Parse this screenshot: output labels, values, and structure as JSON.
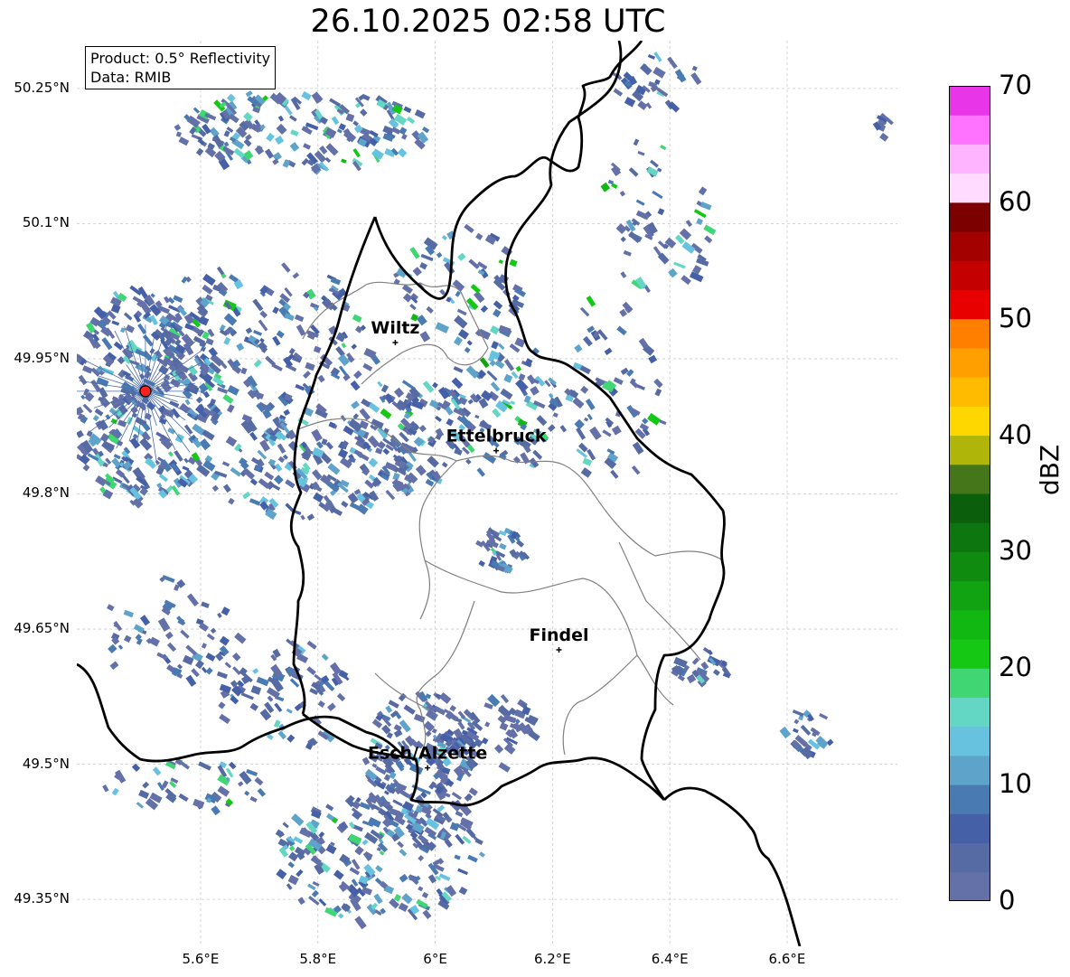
{
  "title": "26.10.2025 02:58 UTC",
  "info": {
    "product": "Product: 0.5° Reflectivity",
    "data_source": "Data: RMIB"
  },
  "map": {
    "lat_ticks": [
      "50.25°N",
      "50.1°N",
      "49.95°N",
      "49.8°N",
      "49.65°N",
      "49.5°N",
      "49.35°N"
    ],
    "lon_ticks": [
      "5.6°E",
      "5.8°E",
      "6°E",
      "6.2°E",
      "6.4°E",
      "6.6°E"
    ],
    "cities": [
      {
        "name": "Wiltz",
        "lat": 49.968,
        "lon": 5.932
      },
      {
        "name": "Ettelbruck",
        "lat": 49.848,
        "lon": 6.104
      },
      {
        "name": "Findel",
        "lat": 49.627,
        "lon": 6.211
      },
      {
        "name": "Esch/Alzette",
        "lat": 49.496,
        "lon": 5.987
      }
    ],
    "radar_site": {
      "lat": 49.914,
      "lon": 5.506
    },
    "radar_site_color": "#ff2020",
    "border_color": "#000000",
    "canton_color": "#808080"
  },
  "colorbar": {
    "label": "dBZ",
    "ticks": [
      "0",
      "10",
      "20",
      "30",
      "40",
      "50",
      "60",
      "70"
    ],
    "colors": [
      "#6470a8",
      "#566aa3",
      "#4560a6",
      "#4a7ab2",
      "#5ea3c9",
      "#66c2de",
      "#63d6c4",
      "#3fd673",
      "#14c814",
      "#12b812",
      "#12a312",
      "#0f8c0f",
      "#0e760e",
      "#0b5e0b",
      "#46761a",
      "#b0b50a",
      "#ffd700",
      "#ffbb00",
      "#ffa000",
      "#ff7f00",
      "#e80000",
      "#c40000",
      "#a30000",
      "#7c0000",
      "#ffdcff",
      "#ffb4ff",
      "#ff73ff",
      "#e835e8"
    ]
  }
}
